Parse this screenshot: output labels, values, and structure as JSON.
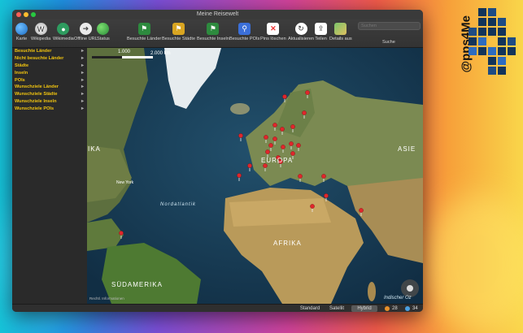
{
  "window": {
    "title": "Meine Reisewelt"
  },
  "toolbar": {
    "items": [
      {
        "label": "Karte",
        "icon": "globe-icon",
        "color": "#2e86de"
      },
      {
        "label": "Wikipedia",
        "icon": "wikipedia-icon",
        "color": "#dcdcdc"
      },
      {
        "label": "Wikimedia",
        "icon": "wikimedia-icon",
        "color": "#2e9c5f"
      },
      {
        "label": "Offline URL",
        "icon": "arrow-right-icon",
        "color": "#eaeaea"
      },
      {
        "label": "Status",
        "icon": "status-globe-icon",
        "color": "#39a84b"
      },
      {
        "label": "Besuchte Länder",
        "icon": "visited-countries-icon",
        "color": "#2d8a3e"
      },
      {
        "label": "Besuchte Städte",
        "icon": "visited-cities-icon",
        "color": "#d9a521"
      },
      {
        "label": "Besuchte Inseln",
        "icon": "visited-islands-icon",
        "color": "#2d8a3e"
      },
      {
        "label": "Besuchte POIs",
        "icon": "visited-pois-icon",
        "color": "#3b6fd8"
      },
      {
        "label": "Pins löschen",
        "icon": "delete-pins-icon",
        "color": "#e33"
      },
      {
        "label": "Aktualisieren",
        "icon": "refresh-icon",
        "color": "#eaeaea"
      },
      {
        "label": "Teilen",
        "icon": "share-icon",
        "color": "#eaeaea"
      },
      {
        "label": "Details aus",
        "icon": "map-details-icon",
        "color": "#d4a53a"
      }
    ],
    "search_placeholder": "Suchen",
    "search_label": "Suche"
  },
  "sidebar": {
    "items": [
      {
        "label": "Besuchte Länder"
      },
      {
        "label": "Nicht besuchte Länder"
      },
      {
        "label": "Städte"
      },
      {
        "label": "Inseln"
      },
      {
        "label": "POIs"
      },
      {
        "label": "Wunschziele Länder"
      },
      {
        "label": "Wunschziele Städte"
      },
      {
        "label": "Wunschziele Inseln"
      },
      {
        "label": "Wunschziele POIs"
      }
    ]
  },
  "map": {
    "scale_label": "1.000",
    "scale_km": "2.000 km",
    "labels": [
      {
        "text": "EUROPA"
      },
      {
        "text": "AFRIKA"
      },
      {
        "text": "SÜDAMERIKA"
      },
      {
        "text": "Nordatlantik"
      },
      {
        "text": "New York"
      },
      {
        "text": "Indischer Oz"
      },
      {
        "text": "ASIE"
      },
      {
        "text": "IKA"
      }
    ],
    "legal": "Rechtl. Informationen",
    "pin_color": "#e0262b"
  },
  "statusbar": {
    "modes": [
      {
        "label": "Standard",
        "selected": false
      },
      {
        "label": "Satellit",
        "selected": false
      },
      {
        "label": "Hybrid",
        "selected": true
      }
    ],
    "count_visited": "28",
    "count_other": "34"
  },
  "brand": {
    "text": "@pps4Me"
  }
}
